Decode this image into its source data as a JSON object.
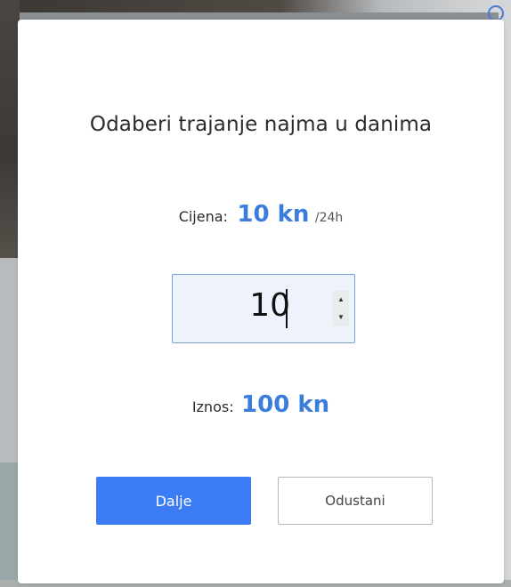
{
  "dialog": {
    "title": "Odaberi trajanje najma u danima",
    "price": {
      "label": "Cijena:",
      "value": "10 kn",
      "unit": "/24h"
    },
    "days_input": {
      "value": "10"
    },
    "total": {
      "label": "Iznos:",
      "value": "100 kn"
    },
    "buttons": {
      "confirm_label": "Dalje",
      "cancel_label": "Odustani"
    }
  },
  "colors": {
    "accent": "#3b7ddd",
    "primary_button": "#3b7cf4",
    "input_background": "#eef3fb",
    "input_border": "#7aa2e0"
  },
  "icons": {
    "spin_up": "caret-up-icon",
    "spin_down": "caret-down-icon",
    "corner": "circle-icon"
  }
}
